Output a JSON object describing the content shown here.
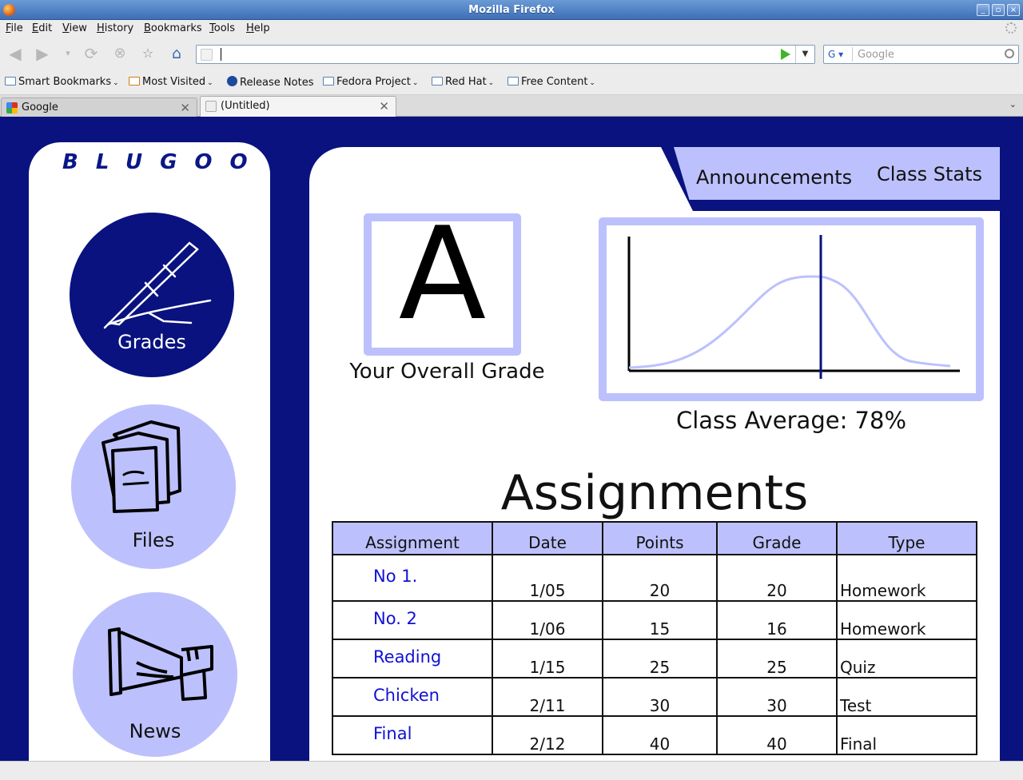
{
  "window": {
    "title": "Mozilla Firefox"
  },
  "menu": [
    "File",
    "Edit",
    "View",
    "History",
    "Bookmarks",
    "Tools",
    "Help"
  ],
  "urlbar": {
    "value": ""
  },
  "search": {
    "engine": "G",
    "placeholder": "Google"
  },
  "bookmarks": [
    {
      "label": "Smart Bookmarks",
      "icon": "folder-icon",
      "menu": true
    },
    {
      "label": "Most Visited",
      "icon": "rss-icon",
      "menu": true
    },
    {
      "label": "Release Notes",
      "icon": "fedora-icon",
      "menu": false
    },
    {
      "label": "Fedora Project",
      "icon": "folder-icon",
      "menu": true
    },
    {
      "label": "Red Hat",
      "icon": "folder-icon",
      "menu": true
    },
    {
      "label": "Free Content",
      "icon": "folder-icon",
      "menu": true
    }
  ],
  "tabs": [
    {
      "label": "Google",
      "active": false
    },
    {
      "label": "(Untitled)",
      "active": true
    }
  ],
  "site": {
    "logo": "BLUGOO",
    "nav": [
      {
        "label": "Grades",
        "icon": "pen-icon",
        "active": true
      },
      {
        "label": "Files",
        "icon": "files-icon",
        "active": false
      },
      {
        "label": "News",
        "icon": "megaphone-icon",
        "active": false
      }
    ],
    "page_tabs": [
      "Announcements",
      "Class Stats"
    ],
    "overall_grade": {
      "letter": "A",
      "caption": "Your Overall Grade"
    },
    "class_average": "Class Average: 78%",
    "assignments_title": "Assignments",
    "table": {
      "headers": [
        "Assignment",
        "Date",
        "Points",
        "Grade",
        "Type"
      ],
      "rows": [
        [
          "No 1.",
          "1/05",
          "20",
          "20",
          "Homework"
        ],
        [
          "No. 2",
          "1/06",
          "15",
          "16",
          "Homework"
        ],
        [
          "Reading",
          "1/15",
          "25",
          "25",
          "Quiz"
        ],
        [
          "Chicken",
          "2/11",
          "30",
          "30",
          "Test"
        ],
        [
          "Final",
          "2/12",
          "40",
          "40",
          "Final"
        ]
      ]
    }
  },
  "colors": {
    "page_bg": "#09127f",
    "accent_light": "#bcc1fd",
    "link": "#1010d8"
  }
}
